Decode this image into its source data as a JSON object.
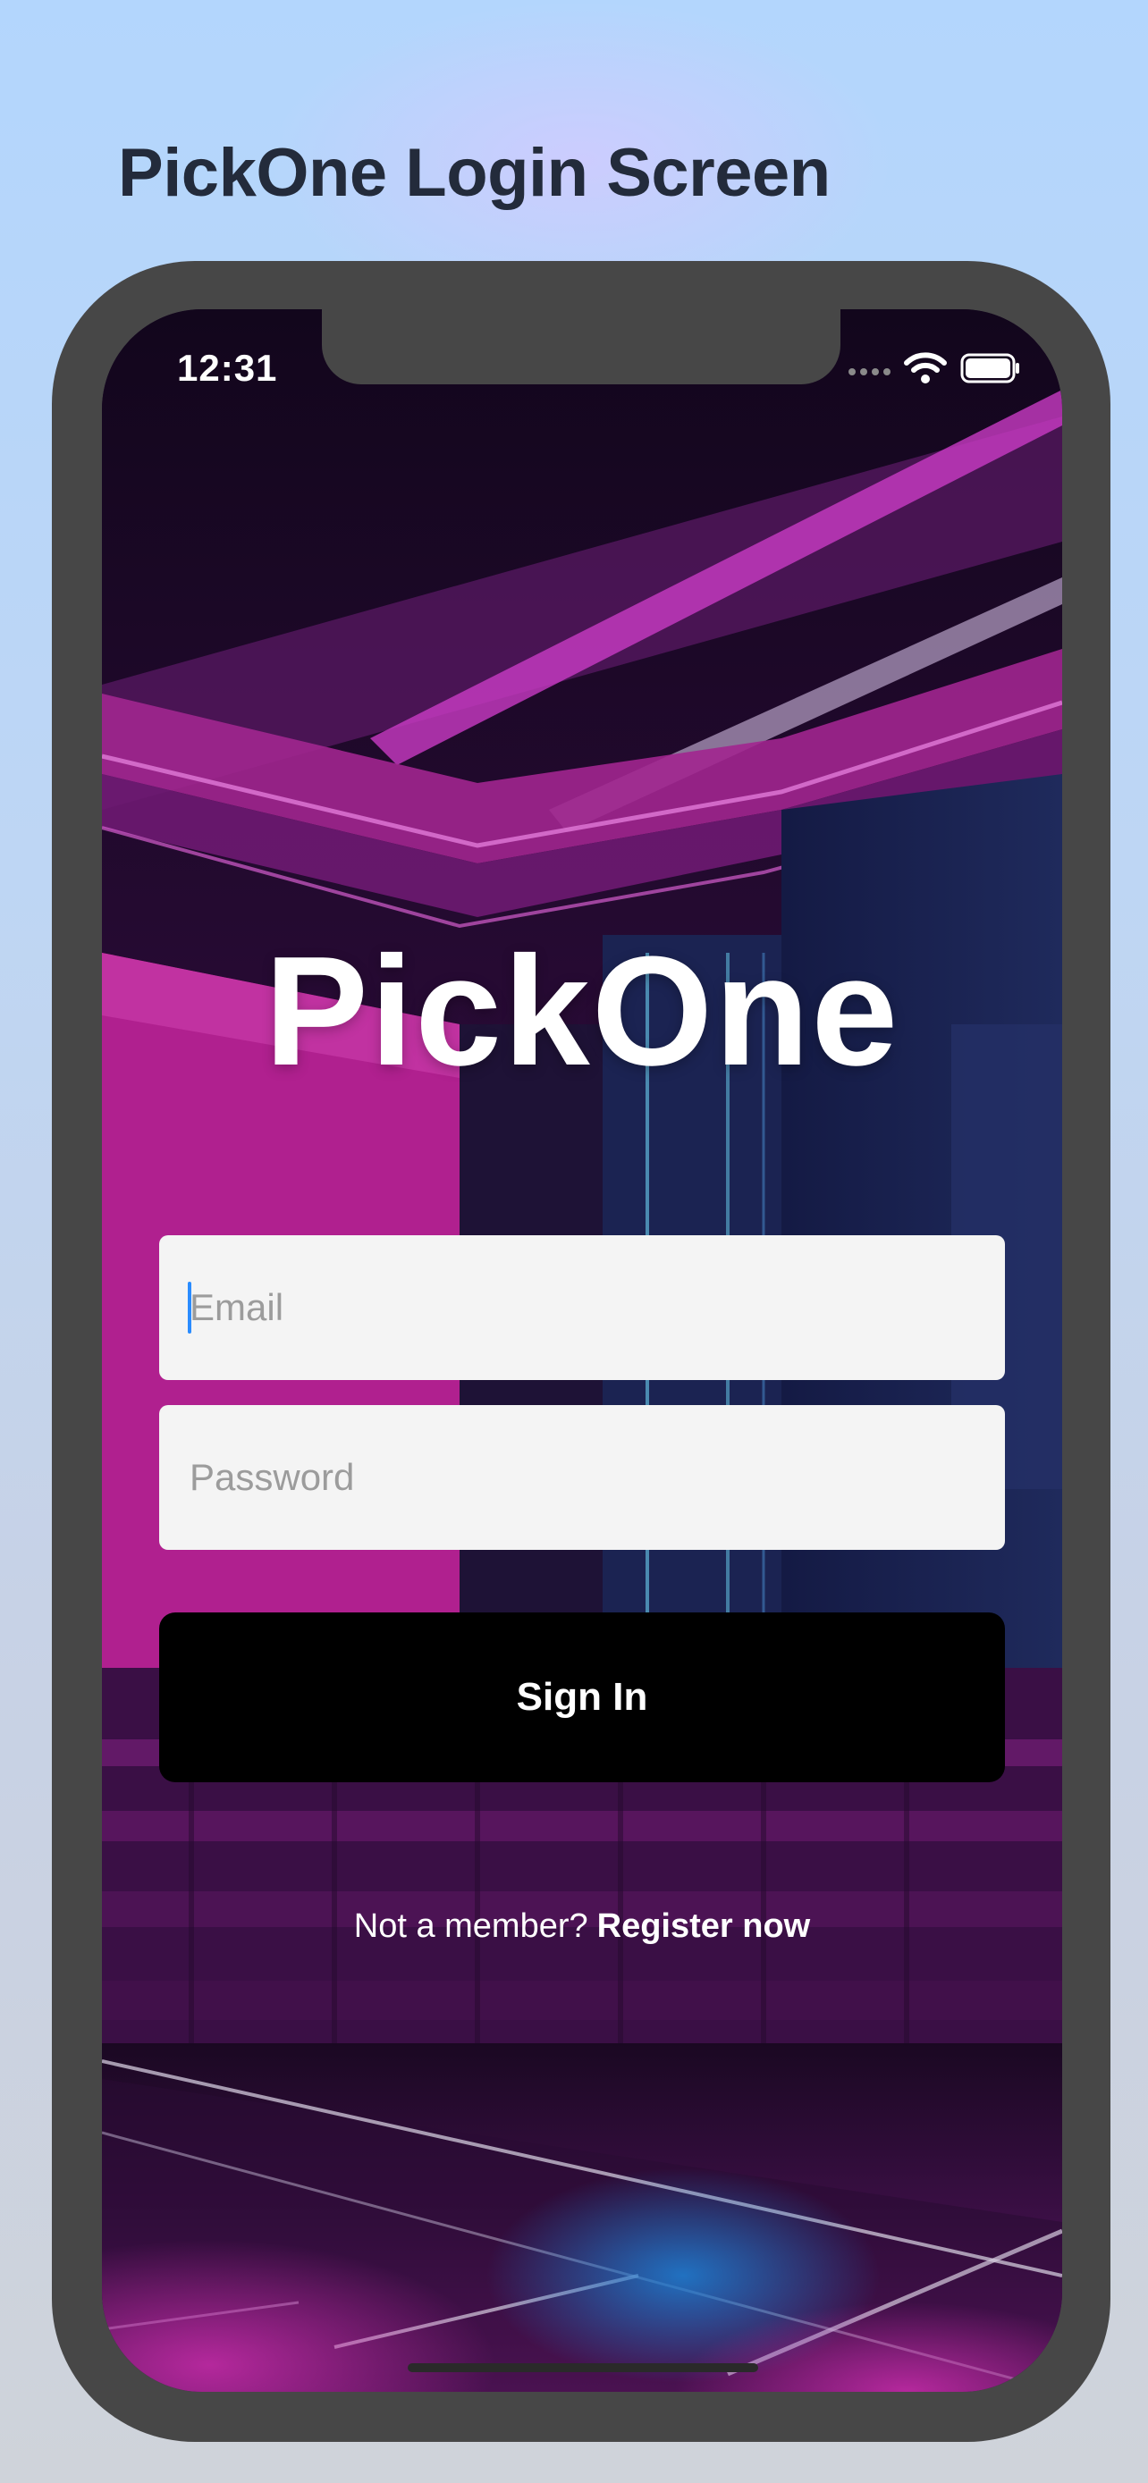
{
  "page": {
    "title": "PickOne Login Screen"
  },
  "status_bar": {
    "time": "12:31",
    "icons": [
      "signal-dots-icon",
      "wifi-icon",
      "battery-icon"
    ]
  },
  "app": {
    "brand": "PickOne"
  },
  "login_form": {
    "email_placeholder": "Email",
    "email_value": "",
    "password_placeholder": "Password",
    "password_value": "",
    "sign_in_label": "Sign In"
  },
  "register": {
    "prompt": "Not a member?",
    "link_label": "Register now"
  },
  "colors": {
    "accent_magenta": "#c0269e",
    "button_bg": "#000000",
    "field_bg": "#f4f4f4",
    "caret": "#2a8cff",
    "frame": "#474747"
  }
}
